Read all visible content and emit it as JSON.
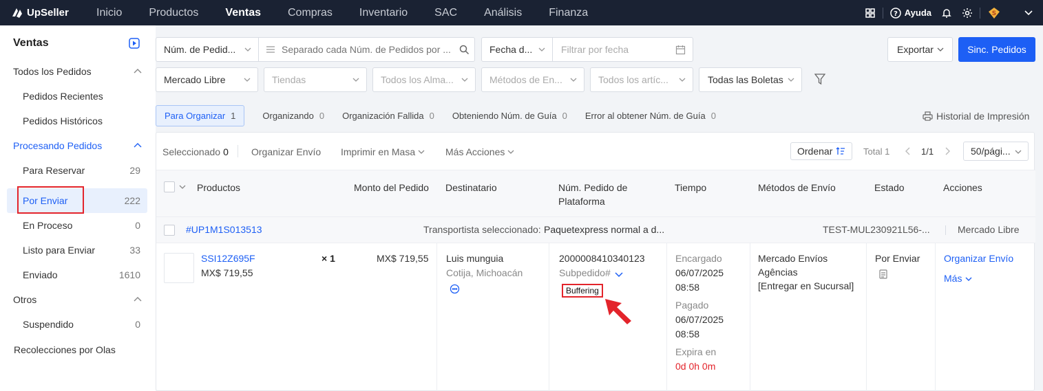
{
  "app": {
    "name": "UpSeller"
  },
  "nav": {
    "items": [
      "Inicio",
      "Productos",
      "Ventas",
      "Compras",
      "Inventario",
      "SAC",
      "Análisis",
      "Finanza"
    ],
    "active": "Ventas",
    "help": "Ayuda"
  },
  "sidebar": {
    "title": "Ventas",
    "all_orders": "Todos los Pedidos",
    "recent": "Pedidos Recientes",
    "history": "Pedidos Históricos",
    "processing": "Procesando Pedidos",
    "items": [
      {
        "label": "Para Reservar",
        "count": "29"
      },
      {
        "label": "Por Enviar",
        "count": "222"
      },
      {
        "label": "En Proceso",
        "count": "0"
      },
      {
        "label": "Listo para Enviar",
        "count": "33"
      },
      {
        "label": "Enviado",
        "count": "1610"
      }
    ],
    "others": "Otros",
    "suspended": {
      "label": "Suspendido",
      "count": "0"
    },
    "waves": "Recolecciones por Olas"
  },
  "filters": {
    "order_num": "Núm. de Pedid...",
    "search_placeholder": "Separado cada Núm. de Pedidos por ...",
    "date_type": "Fecha d...",
    "date_placeholder": "Filtrar por fecha",
    "export": "Exportar",
    "sync": "Sinc. Pedidos",
    "marketplace": "Mercado Libre",
    "stores": "Tiendas",
    "warehouses": "Todos los Alma...",
    "shipping": "Métodos de En...",
    "articles": "Todos los artíc...",
    "invoices": "Todas las Boletas"
  },
  "tabs": [
    {
      "label": "Para Organizar",
      "count": "1"
    },
    {
      "label": "Organizando",
      "count": "0"
    },
    {
      "label": "Organización Fallida",
      "count": "0"
    },
    {
      "label": "Obteniendo Núm. de Guía",
      "count": "0"
    },
    {
      "label": "Error al obtener Núm. de Guía",
      "count": "0"
    }
  ],
  "print_history": "Historial de Impresión",
  "toolbar": {
    "selected_label": "Seleccionado",
    "selected_count": "0",
    "organize": "Organizar Envío",
    "bulk_print": "Imprimir en Masa",
    "more_actions": "Más Acciones",
    "sort": "Ordenar",
    "total": "Total 1",
    "page": "1/1",
    "per_page": "50/pági..."
  },
  "columns": [
    "Productos",
    "Monto del Pedido",
    "Destinatario",
    "Núm. Pedido de Plataforma",
    "Tiempo",
    "Métodos de Envío",
    "Estado",
    "Acciones"
  ],
  "order": {
    "id": "#UP1M1S013513",
    "carrier_label": "Transportista seleccionado:",
    "carrier": "Paquetexpress normal a d...",
    "ref": "TEST-MUL230921L56-...",
    "market": "Mercado Libre",
    "sku": "SSI12Z695F",
    "price": "MX$ 719,55",
    "qty": "× 1",
    "amount": "MX$ 719,55",
    "recipient": "Luis munguia",
    "location": "Cotija, Michoacán",
    "platform_no": "2000008410340123",
    "subpedido": "Subpedido#",
    "buffering": "Buffering",
    "ordered_label": "Encargado",
    "ordered_date": "06/07/2025",
    "ordered_time": "08:58",
    "paid_label": "Pagado",
    "paid_date": "06/07/2025",
    "paid_time": "08:58",
    "expires_label": "Expira en",
    "expires_value": "0d 0h 0m",
    "ship_method_1": "Mercado Envíos",
    "ship_method_2": "Agências",
    "ship_method_3": "[Entregar en Sucursal]",
    "status": "Por Enviar",
    "action_1": "Organizar Envío",
    "action_2": "Más"
  },
  "colors": {
    "accent": "#1d5ff5",
    "topbar": "#1a2233",
    "highlight": "#e3242b"
  }
}
